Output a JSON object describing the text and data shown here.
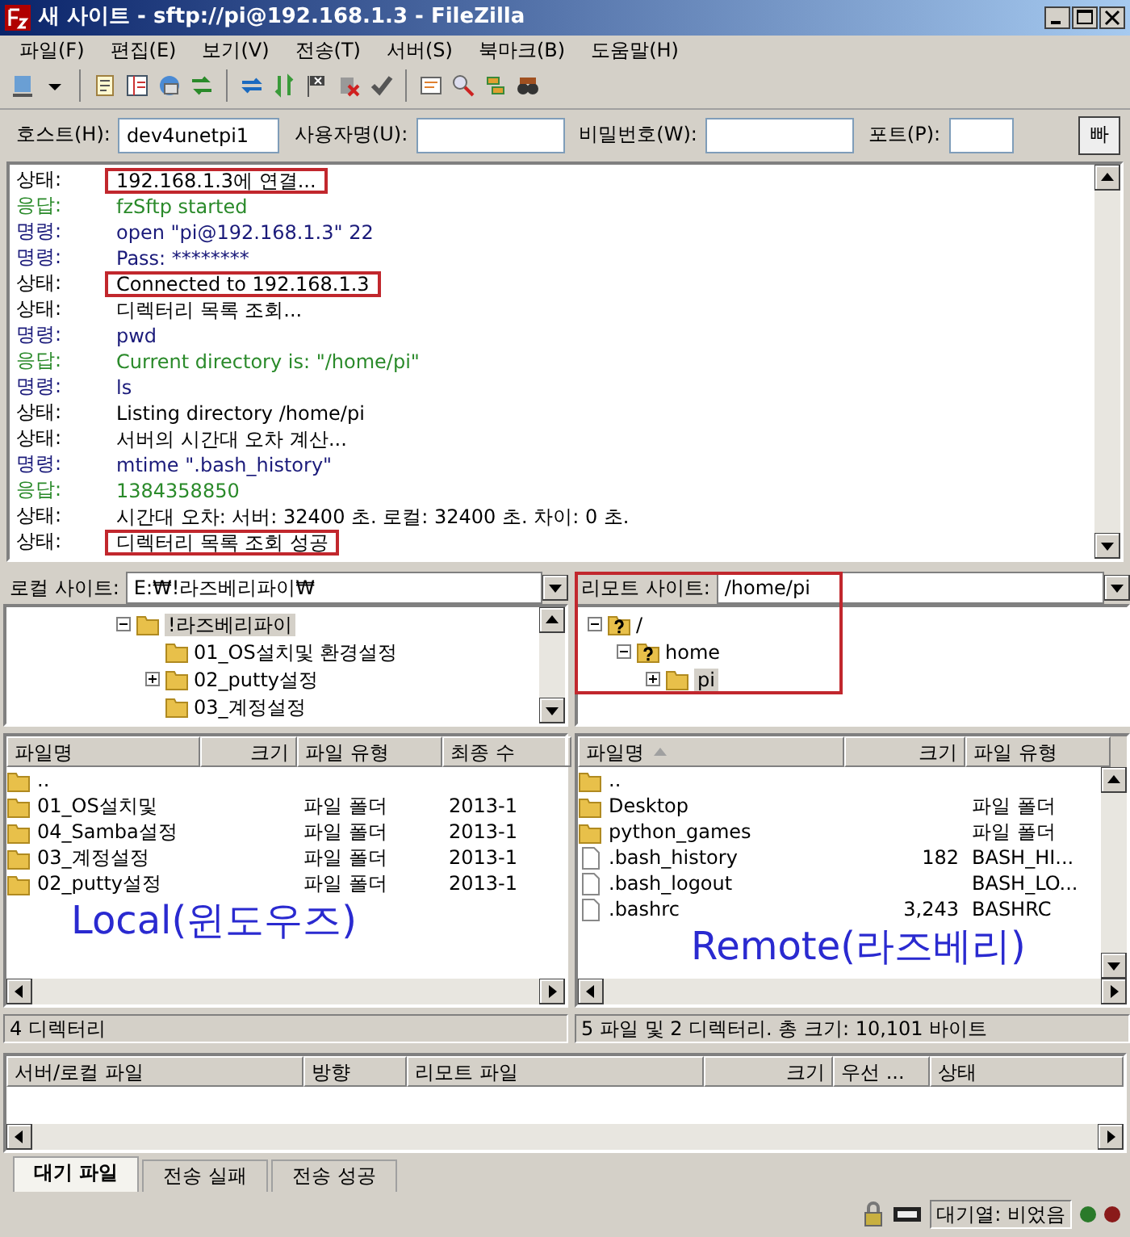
{
  "window": {
    "title": "새 사이트 - sftp://pi@192.168.1.3 - FileZilla"
  },
  "menu": [
    "파일(F)",
    "편집(E)",
    "보기(V)",
    "전송(T)",
    "서버(S)",
    "북마크(B)",
    "도움말(H)"
  ],
  "quickconnect": {
    "fields": [
      {
        "label": "호스트(H):",
        "value": "dev4unetpi1"
      },
      {
        "label": "사용자명(U):"
      },
      {
        "label": "비밀번호(W):"
      },
      {
        "label": "포트(P):"
      }
    ],
    "button": "빠"
  },
  "log": [
    {
      "type": "상태:",
      "kind": "status",
      "text": "192.168.1.3에 연결...",
      "highlighted": true
    },
    {
      "type": "응답:",
      "kind": "response",
      "text": "fzSftp started",
      "highlighted": false
    },
    {
      "type": "명령:",
      "kind": "command",
      "text": "open \"pi@192.168.1.3\" 22",
      "highlighted": false
    },
    {
      "type": "명령:",
      "kind": "command",
      "text": "Pass: ********",
      "highlighted": false
    },
    {
      "type": "상태:",
      "kind": "status",
      "text": "Connected to 192.168.1.3",
      "highlighted": true
    },
    {
      "type": "상태:",
      "kind": "status",
      "text": "디렉터리 목록 조회...",
      "highlighted": false
    },
    {
      "type": "명령:",
      "kind": "command",
      "text": "pwd",
      "highlighted": false
    },
    {
      "type": "응답:",
      "kind": "response",
      "text": "Current directory is: \"/home/pi\"",
      "highlighted": false
    },
    {
      "type": "명령:",
      "kind": "command",
      "text": "ls",
      "highlighted": false
    },
    {
      "type": "상태:",
      "kind": "status",
      "text": "Listing directory /home/pi",
      "highlighted": false
    },
    {
      "type": "상태:",
      "kind": "status",
      "text": "서버의 시간대 오차 계산...",
      "highlighted": false
    },
    {
      "type": "명령:",
      "kind": "command",
      "text": "mtime \".bash_history\"",
      "highlighted": false
    },
    {
      "type": "응답:",
      "kind": "response",
      "text": "1384358850",
      "highlighted": false
    },
    {
      "type": "상태:",
      "kind": "status",
      "text": "시간대 오차: 서버: 32400 초. 로컬: 32400 초. 차이: 0 초.",
      "highlighted": false
    },
    {
      "type": "상태:",
      "kind": "status",
      "text": "디렉터리 목록 조회 성공",
      "highlighted": true
    }
  ],
  "local": {
    "site_label": "로컬 사이트:",
    "path": "E:₩!라즈베리파이₩",
    "highlighted": false,
    "tree": [
      {
        "label": "!라즈베리파이",
        "kind": "folder",
        "expanded": true,
        "selected": true,
        "children": [
          {
            "label": "01_OS설치및 환경설정",
            "kind": "folder",
            "selected": false
          },
          {
            "label": "02_putty설정",
            "kind": "folder",
            "expanded": false,
            "selected": false
          },
          {
            "label": "03_계정설정",
            "kind": "folder",
            "selected": false
          }
        ]
      }
    ],
    "columns": [
      "파일명",
      "크기",
      "파일 유형",
      "최종 수"
    ],
    "sorted_by_name": false,
    "files": [
      {
        "kind": "folder",
        "cells": [
          "..",
          "",
          "",
          ""
        ]
      },
      {
        "kind": "folder",
        "cells": [
          "01_OS설치및",
          "",
          "파일 폴더",
          "2013-1"
        ]
      },
      {
        "kind": "folder",
        "cells": [
          "04_Samba설정",
          "",
          "파일 폴더",
          "2013-1"
        ]
      },
      {
        "kind": "folder",
        "cells": [
          "03_계정설정",
          "",
          "파일 폴더",
          "2013-1"
        ]
      },
      {
        "kind": "folder",
        "cells": [
          "02_putty설정",
          "",
          "파일 폴더",
          "2013-1"
        ]
      }
    ],
    "annotation": "Local(윈도우즈)",
    "status": "4 디렉터리"
  },
  "remote": {
    "site_label": "리모트 사이트:",
    "path": "/home/pi",
    "highlighted": true,
    "tree": [
      {
        "label": "/",
        "kind": "unknown",
        "expanded": true,
        "selected": false,
        "children": [
          {
            "label": "home",
            "kind": "unknown",
            "expanded": true,
            "selected": false,
            "children": [
              {
                "label": "pi",
                "kind": "folder",
                "expanded": false,
                "selected": true
              }
            ]
          }
        ]
      }
    ],
    "columns": [
      "파일명",
      "크기",
      "파일 유형"
    ],
    "sorted_by_name": true,
    "files": [
      {
        "kind": "folder",
        "cells": [
          "..",
          "",
          ""
        ]
      },
      {
        "kind": "folder",
        "cells": [
          "Desktop",
          "",
          "파일 폴더"
        ]
      },
      {
        "kind": "folder",
        "cells": [
          "python_games",
          "",
          "파일 폴더"
        ]
      },
      {
        "kind": "file",
        "cells": [
          ".bash_history",
          "182",
          "BASH_HI..."
        ]
      },
      {
        "kind": "file",
        "cells": [
          ".bash_logout",
          "",
          "BASH_LO..."
        ]
      },
      {
        "kind": "file",
        "cells": [
          ".bashrc",
          "3,243",
          "BASHRC"
        ]
      }
    ],
    "annotation": "Remote(라즈베리)",
    "status": "5 파일 및 2 디렉터리. 총 크기: 10,101 바이트"
  },
  "queue": {
    "columns": [
      "서버/로컬 파일",
      "방향",
      "리모트 파일",
      "크기",
      "우선 ...",
      "상태"
    ]
  },
  "tabs": [
    {
      "label": "대기 파일",
      "selected": true
    },
    {
      "label": "전송 실패",
      "selected": false
    },
    {
      "label": "전송 성공",
      "selected": false
    }
  ],
  "status_bar": {
    "text": "대기열: 비었음"
  }
}
